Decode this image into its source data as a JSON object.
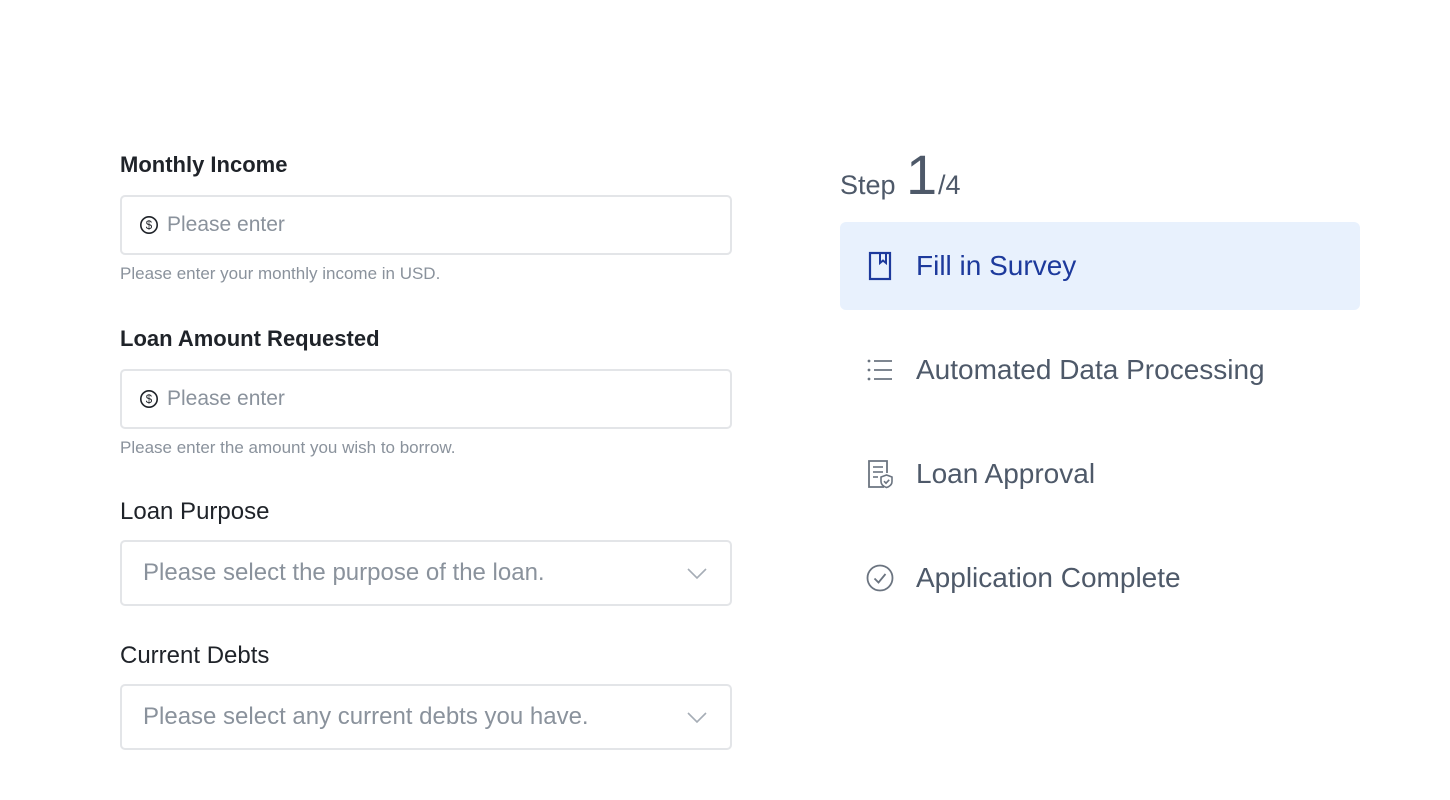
{
  "form": {
    "monthly_income": {
      "label": "Monthly Income",
      "placeholder": "Please enter",
      "hint": "Please enter your monthly income in USD.",
      "icon": "dollar-circle-icon"
    },
    "loan_amount": {
      "label": "Loan Amount Requested",
      "placeholder": "Please enter",
      "hint": "Please enter the amount you wish to borrow.",
      "icon": "dollar-circle-icon"
    },
    "loan_purpose": {
      "label": "Loan Purpose",
      "placeholder": "Please select the purpose of the loan.",
      "icon": "chevron-down-icon"
    },
    "current_debts": {
      "label": "Current Debts",
      "placeholder": "Please select any current debts you have.",
      "icon": "chevron-down-icon"
    }
  },
  "progress": {
    "word": "Step",
    "current": "1",
    "total": "/4",
    "current_step_fraction": 0.25
  },
  "steps": [
    {
      "label": "Fill in Survey",
      "icon": "bookmark-icon",
      "active": true
    },
    {
      "label": "Automated Data Processing",
      "icon": "list-icon",
      "active": false
    },
    {
      "label": "Loan Approval",
      "icon": "document-check-icon",
      "active": false
    },
    {
      "label": "Application Complete",
      "icon": "check-circle-icon",
      "active": false
    }
  ],
  "colors": {
    "active_bg": "#e8f1fd",
    "active_text": "#1d3a9c",
    "inactive_text": "#4e5969",
    "border": "#e3e5e8",
    "hint_text": "#8a929c"
  }
}
